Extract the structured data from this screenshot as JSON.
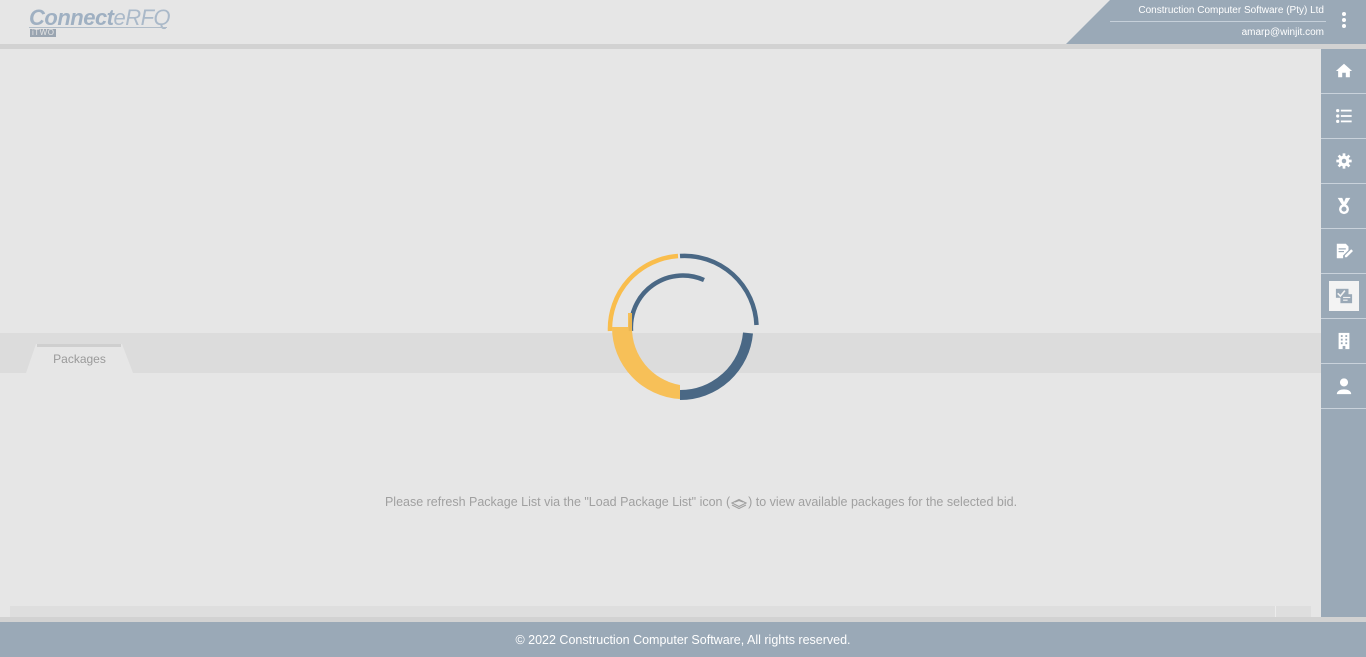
{
  "header": {
    "logo": {
      "brand": "Connect",
      "product": "eRFQ",
      "sub": "iTWO"
    },
    "company": "Construction Computer Software (Pty) Ltd",
    "user_email": "amarp@winjit.com"
  },
  "sidebar": {
    "items": [
      {
        "icon": "home-icon"
      },
      {
        "icon": "list-icon"
      },
      {
        "icon": "gear-icon"
      },
      {
        "icon": "award-icon"
      },
      {
        "icon": "edit-document-icon"
      },
      {
        "icon": "packages-icon",
        "active": true
      },
      {
        "icon": "building-icon"
      },
      {
        "icon": "user-icon"
      }
    ]
  },
  "tabs": [
    {
      "label": "Packages"
    }
  ],
  "main": {
    "message_before": "Please refresh Package List via the \"Load Package List\" icon (",
    "message_after": ") to view available packages for the selected bid."
  },
  "footer": {
    "copyright": "© 2022 Construction Computer Software, All rights reserved."
  },
  "colors": {
    "accent": "#9aa9b7",
    "spinner_blue": "#4a6885",
    "spinner_yellow": "#f9bd4c"
  }
}
